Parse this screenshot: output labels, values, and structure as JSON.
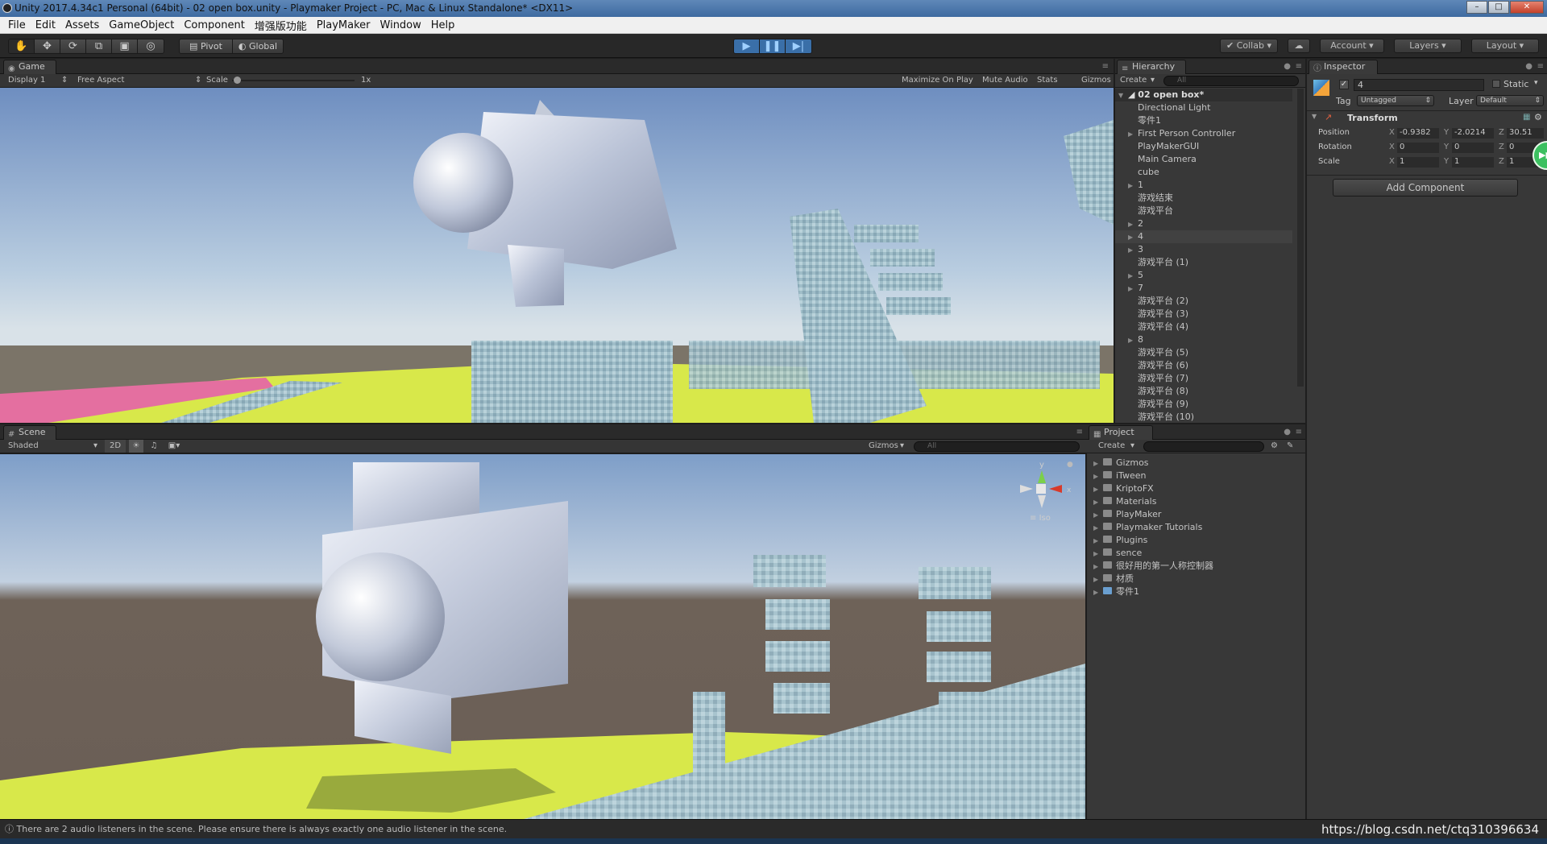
{
  "window": {
    "title": "Unity 2017.4.34c1 Personal (64bit) - 02 open box.unity - Playmaker Project - PC, Mac & Linux Standalone* <DX11>"
  },
  "menu": [
    "File",
    "Edit",
    "Assets",
    "GameObject",
    "Component",
    "增强版功能",
    "PlayMaker",
    "Window",
    "Help"
  ],
  "toolbar": {
    "pivot": "Pivot",
    "global": "Global",
    "collab": "Collab",
    "account": "Account",
    "layers": "Layers",
    "layout": "Layout"
  },
  "game": {
    "tab": "Game",
    "display": "Display 1",
    "aspect": "Free Aspect",
    "scale_label": "Scale",
    "scale_value": "1x",
    "maximize": "Maximize On Play",
    "mute": "Mute Audio",
    "stats": "Stats",
    "gizmos": "Gizmos"
  },
  "scene": {
    "tab": "Scene",
    "shading": "Shaded",
    "mode2d": "2D",
    "gizmos": "Gizmos",
    "search": "All",
    "gizmo_y": "y",
    "gizmo_x": "x",
    "projection": "Iso"
  },
  "hierarchy": {
    "tab": "Hierarchy",
    "create": "Create",
    "search": "All",
    "scene_name": "02 open box*",
    "items": [
      {
        "label": "Directional Light",
        "arrow": false
      },
      {
        "label": "零件1",
        "arrow": false
      },
      {
        "label": "First Person Controller",
        "arrow": true
      },
      {
        "label": "PlayMakerGUI",
        "arrow": false
      },
      {
        "label": "Main Camera",
        "arrow": false
      },
      {
        "label": "cube",
        "arrow": false
      },
      {
        "label": "1",
        "arrow": true
      },
      {
        "label": "游戏结束",
        "arrow": false
      },
      {
        "label": "游戏平台",
        "arrow": false
      },
      {
        "label": "2",
        "arrow": true
      },
      {
        "label": "4",
        "arrow": true,
        "selected": true
      },
      {
        "label": "3",
        "arrow": true
      },
      {
        "label": "游戏平台 (1)",
        "arrow": false
      },
      {
        "label": "5",
        "arrow": true
      },
      {
        "label": "7",
        "arrow": true
      },
      {
        "label": "游戏平台 (2)",
        "arrow": false
      },
      {
        "label": "游戏平台 (3)",
        "arrow": false
      },
      {
        "label": "游戏平台 (4)",
        "arrow": false
      },
      {
        "label": "8",
        "arrow": true
      },
      {
        "label": "游戏平台 (5)",
        "arrow": false
      },
      {
        "label": "游戏平台 (6)",
        "arrow": false
      },
      {
        "label": "游戏平台 (7)",
        "arrow": false
      },
      {
        "label": "游戏平台 (8)",
        "arrow": false
      },
      {
        "label": "游戏平台 (9)",
        "arrow": false
      },
      {
        "label": "游戏平台 (10)",
        "arrow": false
      }
    ]
  },
  "project": {
    "tab": "Project",
    "create": "Create",
    "items": [
      "Gizmos",
      "iTween",
      "KriptoFX",
      "Materials",
      "PlayMaker",
      "Playmaker Tutorials",
      "Plugins",
      "sence",
      "很好用的第一人称控制器",
      "材质",
      "零件1"
    ]
  },
  "inspector": {
    "tab": "Inspector",
    "object_name": "4",
    "static_label": "Static",
    "tag_label": "Tag",
    "tag_value": "Untagged",
    "layer_label": "Layer",
    "layer_value": "Default",
    "component": "Transform",
    "position": {
      "label": "Position",
      "x": "-0.9382",
      "y": "-2.0214",
      "z": "30.51"
    },
    "rotation": {
      "label": "Rotation",
      "x": "0",
      "y": "0",
      "z": "0"
    },
    "scale": {
      "label": "Scale",
      "x": "1",
      "y": "1",
      "z": "1"
    },
    "add_component": "Add Component"
  },
  "status": {
    "message": "There are 2 audio listeners in the scene. Please ensure there is always exactly one audio listener in the scene.",
    "watermark": "https://blog.csdn.net/ctq310396634"
  },
  "colors": {
    "ground": "#d8e84a",
    "sky_top": "#6e8ec0",
    "panel": "#383838",
    "selected": "#3e5f96"
  }
}
